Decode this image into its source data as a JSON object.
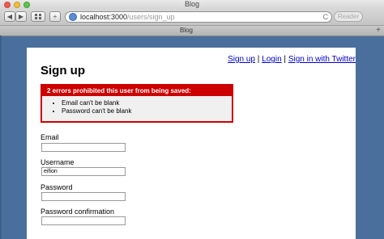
{
  "window": {
    "title": "Blog"
  },
  "toolbar": {
    "back_label": "◀",
    "forward_label": "▶",
    "add_label": "+",
    "reload_label": "C",
    "url_host": "localhost:3000",
    "url_path": "/users/sign_up",
    "reader_label": "Reader"
  },
  "tabs": {
    "active": "Blog",
    "new_tab_label": "+"
  },
  "page": {
    "heading": "Sign up",
    "nav": {
      "sign_up": "Sign up",
      "sep1": "|",
      "login": "Login",
      "sep2": "|",
      "twitter": "Sign in with Twitter"
    },
    "errors": {
      "title": "2 errors prohibited this user from being saved:",
      "items": [
        "Email can't be blank",
        "Password can't be blank"
      ]
    },
    "form": {
      "email_label": "Email",
      "email_value": "",
      "username_label": "Username",
      "username_value": "eifion",
      "password_label": "Password",
      "password_value": "",
      "password_confirmation_label": "Password confirmation",
      "password_confirmation_value": ""
    }
  }
}
